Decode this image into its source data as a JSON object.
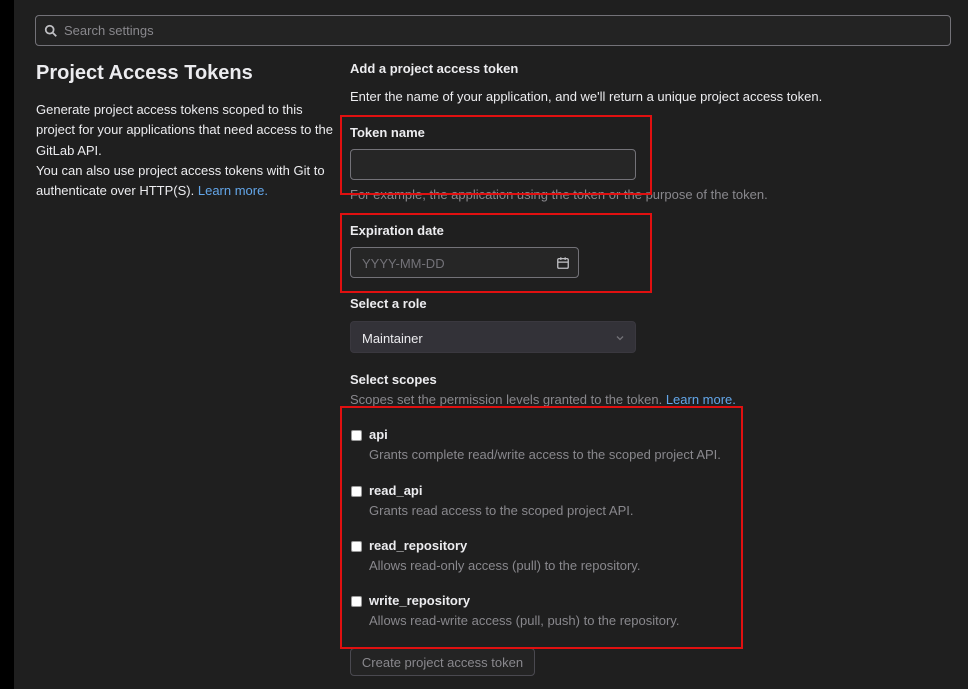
{
  "search": {
    "placeholder": "Search settings"
  },
  "page": {
    "title": "Project Access Tokens",
    "description": "Generate project access tokens scoped to this project for your applications that need access to the GitLab API.",
    "description_2": "You can also use project access tokens with Git to authenticate over HTTP(S).",
    "learn_more": "Learn more."
  },
  "form": {
    "section_title": "Add a project access token",
    "section_desc": "Enter the name of your application, and we'll return a unique project access token.",
    "token_name_label": "Token name",
    "token_name_value": "",
    "token_name_help": "For example, the application using the token or the purpose of the token.",
    "expiration_label": "Expiration date",
    "expiration_placeholder": "YYYY-MM-DD",
    "role_label": "Select a role",
    "role_value": "Maintainer",
    "scopes_label": "Select scopes",
    "scopes_help": "Scopes set the permission levels granted to the token.",
    "scopes_learn_more": "Learn more.",
    "scopes": [
      {
        "name": "api",
        "desc": "Grants complete read/write access to the scoped project API.",
        "checked": false
      },
      {
        "name": "read_api",
        "desc": "Grants read access to the scoped project API.",
        "checked": false
      },
      {
        "name": "read_repository",
        "desc": "Allows read-only access (pull) to the repository.",
        "checked": false
      },
      {
        "name": "write_repository",
        "desc": "Allows read-write access (pull, push) to the repository.",
        "checked": false
      }
    ],
    "submit_label": "Create project access token"
  },
  "colors": {
    "highlight": "#e01010",
    "link": "#63a6e9",
    "background": "#1f1f1f"
  },
  "icons": [
    "search-icon",
    "calendar-icon",
    "chevron-down-icon"
  ]
}
